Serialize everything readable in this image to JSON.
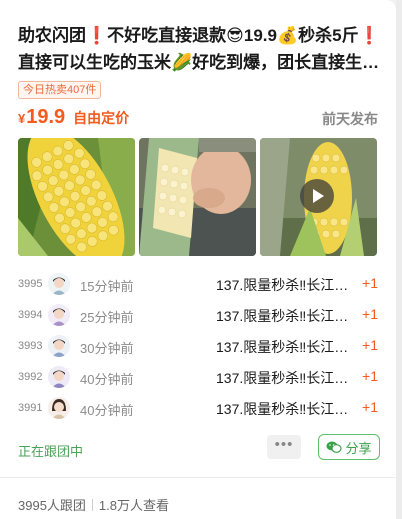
{
  "post": {
    "title": "助农闪团❗不好吃直接退款😎19.9💰秒杀5斤❗直接可以生吃的玉米🌽好吃到爆，团长直接生…",
    "hot_badge": "今日热卖407件",
    "price_symbol": "¥",
    "price_value": "19.9",
    "price_tag": "自由定价",
    "posted": "前天发布"
  },
  "photos": [
    {
      "name": "corn-photo-1",
      "icon": "corn-cob-image"
    },
    {
      "name": "corn-photo-2",
      "icon": "corn-in-hand-image"
    },
    {
      "name": "corn-video",
      "icon": "play-icon"
    }
  ],
  "orders": [
    {
      "num": "3995",
      "time": "15分钟前",
      "item": "137.限量秒杀‼长江…",
      "qty": "+1",
      "avatar": "boy-avatar"
    },
    {
      "num": "3994",
      "time": "25分钟前",
      "item": "137.限量秒杀‼长江…",
      "qty": "+1",
      "avatar": "boy-avatar-purple"
    },
    {
      "num": "3993",
      "time": "30分钟前",
      "item": "137.限量秒杀‼长江…",
      "qty": "+1",
      "avatar": "boy-avatar"
    },
    {
      "num": "3992",
      "time": "40分钟前",
      "item": "137.限量秒杀‼长江…",
      "qty": "+1",
      "avatar": "boy-avatar-purple"
    },
    {
      "num": "3991",
      "time": "40分钟前",
      "item": "137.限量秒杀‼长江…",
      "qty": "+1",
      "avatar": "girl-avatar"
    }
  ],
  "footer": {
    "following": "正在跟团中",
    "more": "•••",
    "share": "分享",
    "participants": "3995人跟团",
    "views": "1.8万人查看"
  },
  "colors": {
    "accent_orange": "#f25a1e",
    "green": "#4aa35a"
  }
}
